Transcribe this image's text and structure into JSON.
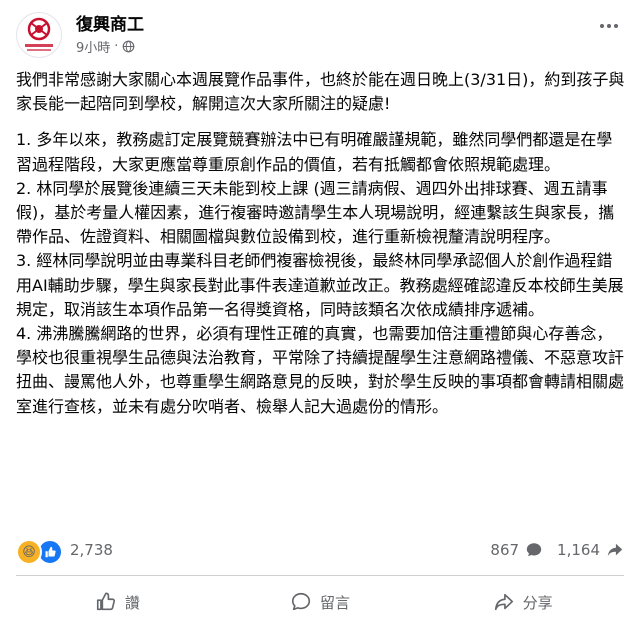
{
  "header": {
    "page_name": "復興商工",
    "timestamp": "9小時",
    "avatar_text": "復興商工"
  },
  "post": {
    "intro": "我們非常感謝大家關心本週展覽作品事件，也終於能在週日晚上(3/31日)，約到孩子與家長能一起陪同到學校，解開這次大家所關注的疑慮!",
    "points": [
      "1. 多年以來，教務處訂定展覽競賽辦法中已有明確嚴謹規範，雖然同學們都還是在學習過程階段，大家更應當尊重原創作品的價值，若有抵觸都會依照規範處理。",
      "2. 林同學於展覽後連續三天未能到校上課 (週三請病假、週四外出排球賽、週五請事假)，基於考量人權因素，進行複審時邀請學生本人現場說明，經連繫該生與家長，攜帶作品、佐證資料、相關圖檔與數位設備到校，進行重新檢視釐清說明程序。",
      "3. 經林同學說明並由專業科目老師們複審檢視後，最終林同學承認個人於創作過程錯用AI輔助步驟，學生與家長對此事件表達道歉並改正。教務處經確認違反本校師生美展規定，取消該生本項作品第一名得獎資格，同時該類名次依成績排序遞補。",
      "4. 沸沸騰騰網路的世界，必須有理性正確的真實，也需要加倍注重禮節與心存善念，學校也很重視學生品德與法治教育，平常除了持續提醒學生注意網路禮儀、不惡意攻訐扭曲、謾罵他人外，也尊重學生網路意見的反映，對於學生反映的事項都會轉請相關處室進行查核，並未有處分吹哨者、檢舉人記大過處份的情形。"
    ]
  },
  "stats": {
    "reactions": "2,738",
    "comments": "867",
    "shares": "1,164"
  },
  "actions": {
    "like": "讚",
    "comment": "留言",
    "share": "分享"
  },
  "colors": {
    "like_blue": "#1877f2",
    "haha_yellow": "#f7b125",
    "muted": "#65676b",
    "logo_red": "#c8102e"
  }
}
